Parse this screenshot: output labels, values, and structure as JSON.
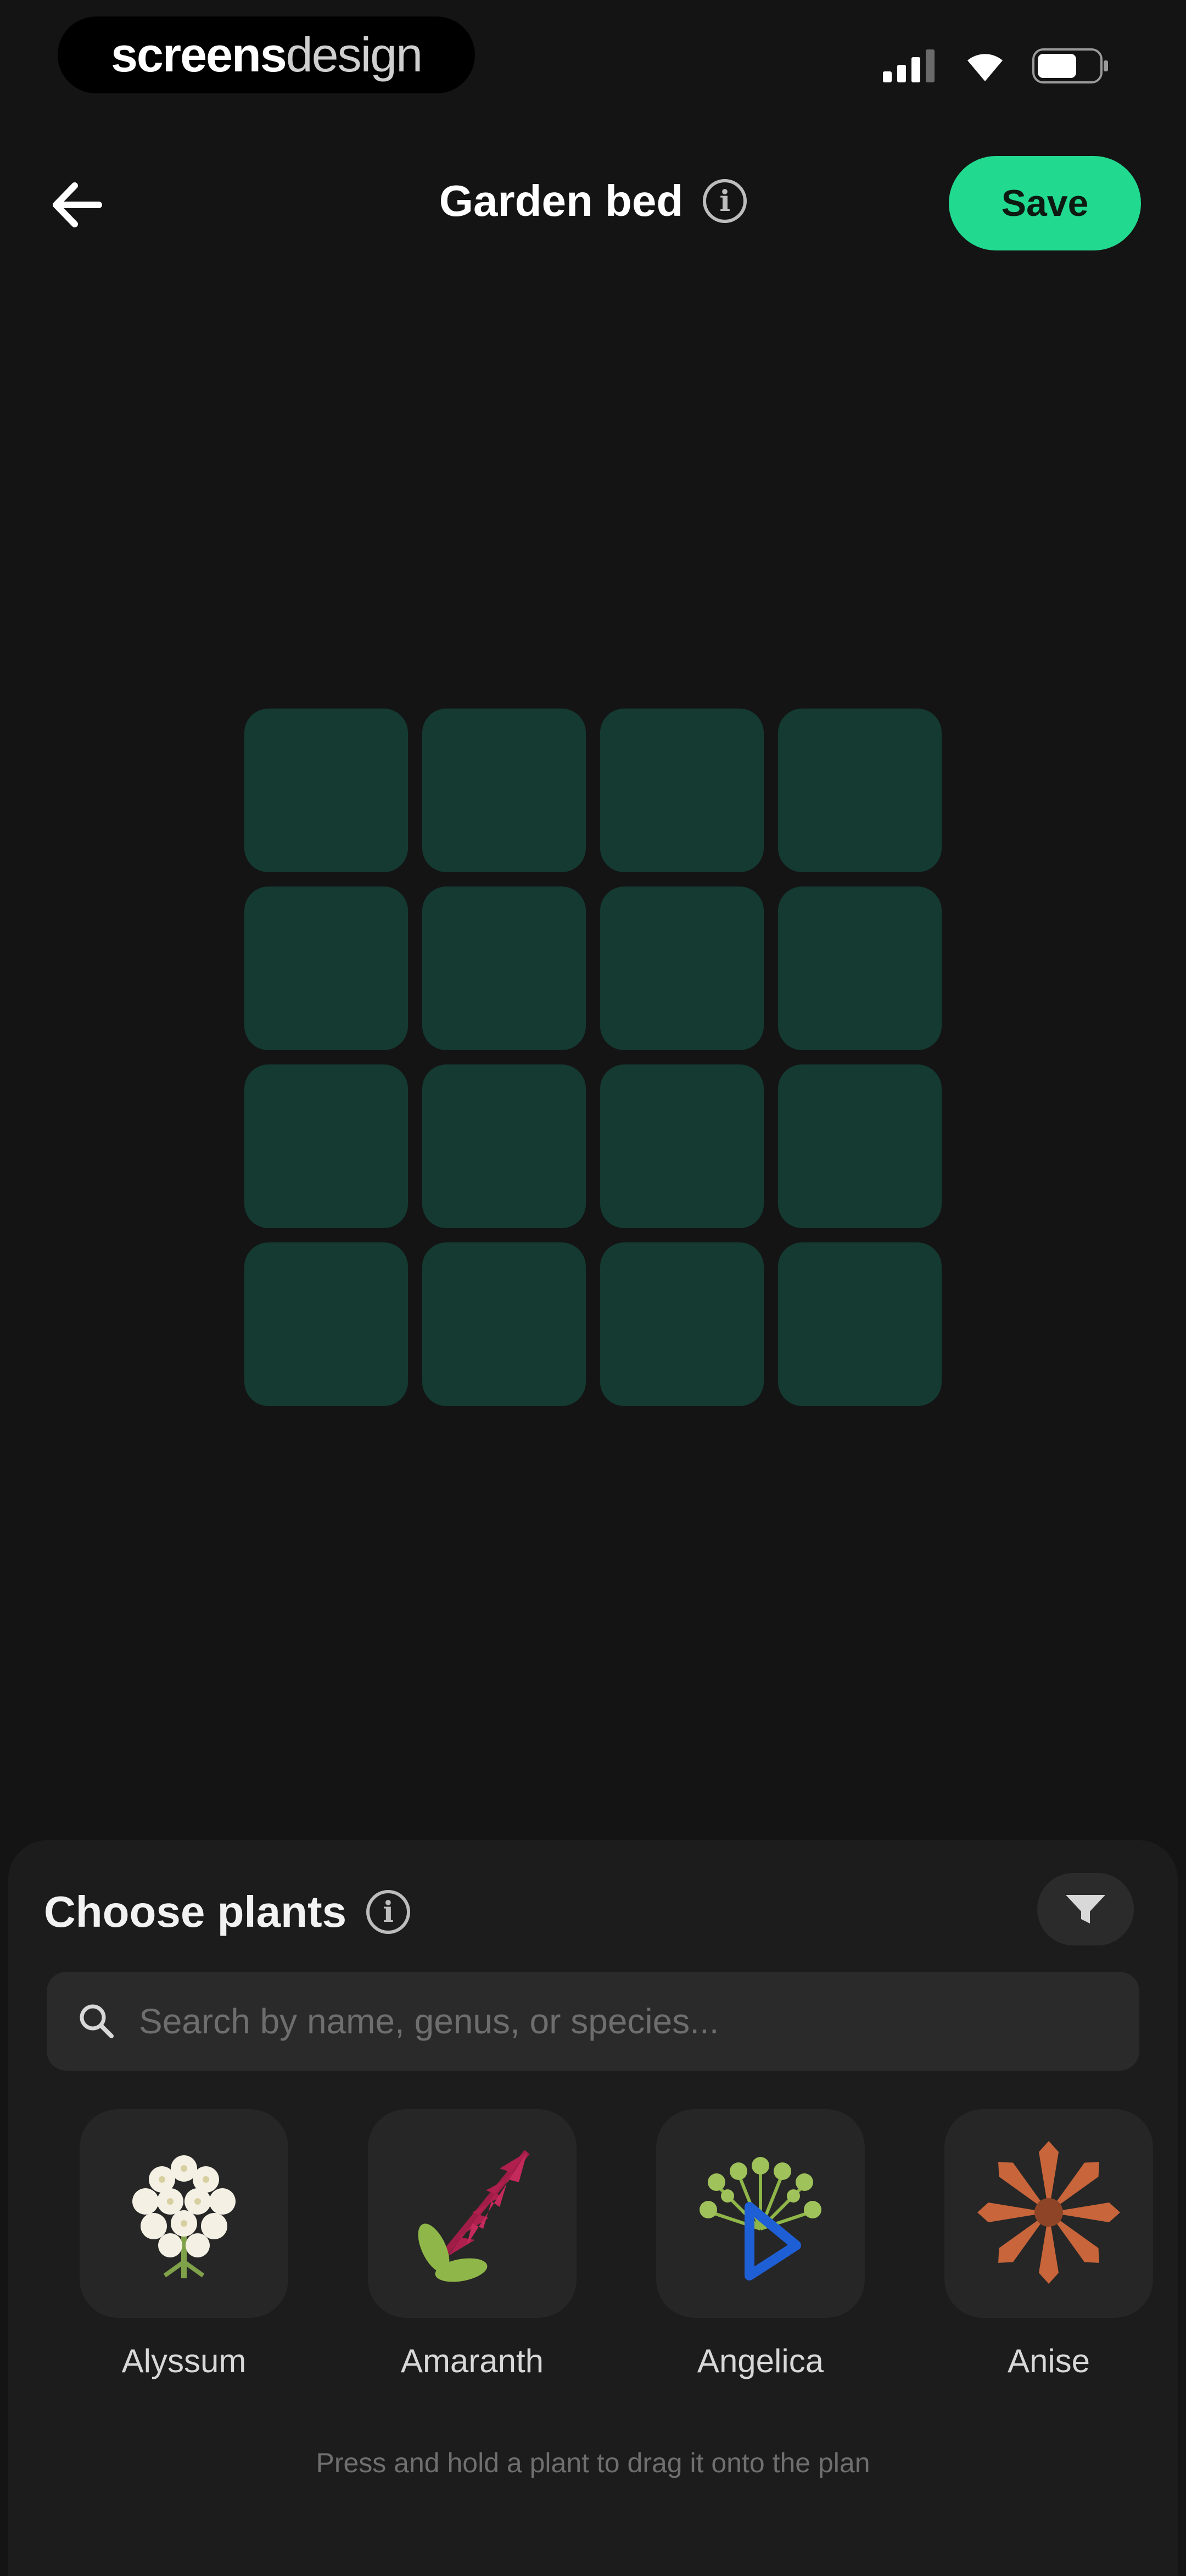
{
  "status_bar": {
    "brand_part1": "screens",
    "brand_part2": "design"
  },
  "header": {
    "title": "Garden bed",
    "save_label": "Save"
  },
  "grid": {
    "rows": 4,
    "cols": 4
  },
  "sheet": {
    "title": "Choose plants",
    "search_placeholder": "Search by name, genus, or species...",
    "plants": [
      {
        "name": "Alyssum",
        "icon": "alyssum-icon"
      },
      {
        "name": "Amaranth",
        "icon": "amaranth-icon"
      },
      {
        "name": "Angelica",
        "icon": "angelica-icon"
      },
      {
        "name": "Anise",
        "icon": "anise-icon"
      }
    ],
    "hint": "Press and hold a plant to drag it onto the plan"
  },
  "colors": {
    "background": "#141414",
    "accent": "#22d990",
    "grid_cell": "#143a31",
    "sheet": "#1c1c1c"
  }
}
